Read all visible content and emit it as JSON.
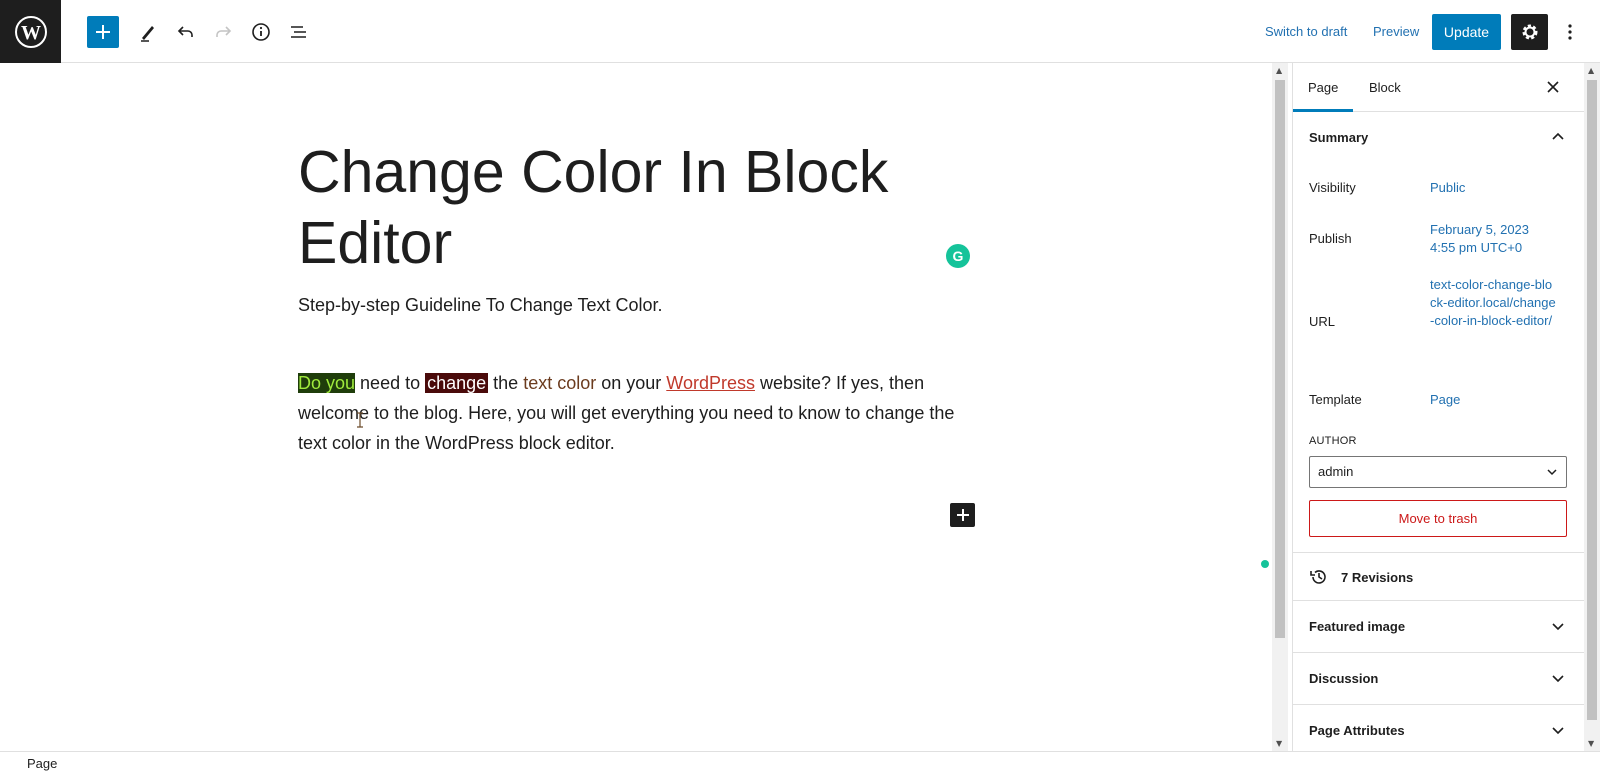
{
  "toolbar": {
    "switch_to_draft": "Switch to draft",
    "preview": "Preview",
    "update": "Update",
    "icons": [
      "wordpress-logo",
      "plus-icon",
      "pencil-icon",
      "undo-icon",
      "redo-icon",
      "info-icon",
      "list-view-icon",
      "gear-icon",
      "more-vertical-icon"
    ],
    "accent_color": "#007cba"
  },
  "editor": {
    "title": "Change Color In Block Editor",
    "subtitle": "Step-by-step Guideline To Change Text Color.",
    "paragraph": {
      "seg1": "Do you",
      "seg2": " need to ",
      "seg3": "change",
      "seg4": " the ",
      "seg5": "text color",
      "seg6": " on your ",
      "seg7": "WordPress",
      "seg8": " website? If yes, then welcome to the blog. Here, you will get everything you need to know to change the text color in the WordPress block editor."
    },
    "grammarly_letter": "G"
  },
  "sidebar": {
    "tabs": {
      "page": "Page",
      "block": "Block"
    },
    "summary": {
      "title": "Summary",
      "visibility_label": "Visibility",
      "visibility_value": "Public",
      "publish_label": "Publish",
      "publish_date": "February 5, 2023",
      "publish_time": "4:55 pm UTC+0",
      "url_label": "URL",
      "url_value": "text-color-change-block-editor.local/change-color-in-block-editor/",
      "template_label": "Template",
      "template_value": "Page",
      "author_label": "AUTHOR",
      "author_value": "admin",
      "trash": "Move to trash"
    },
    "revisions": "7 Revisions",
    "panels": [
      "Featured image",
      "Discussion",
      "Page Attributes"
    ]
  },
  "footer": {
    "breadcrumb": "Page"
  }
}
